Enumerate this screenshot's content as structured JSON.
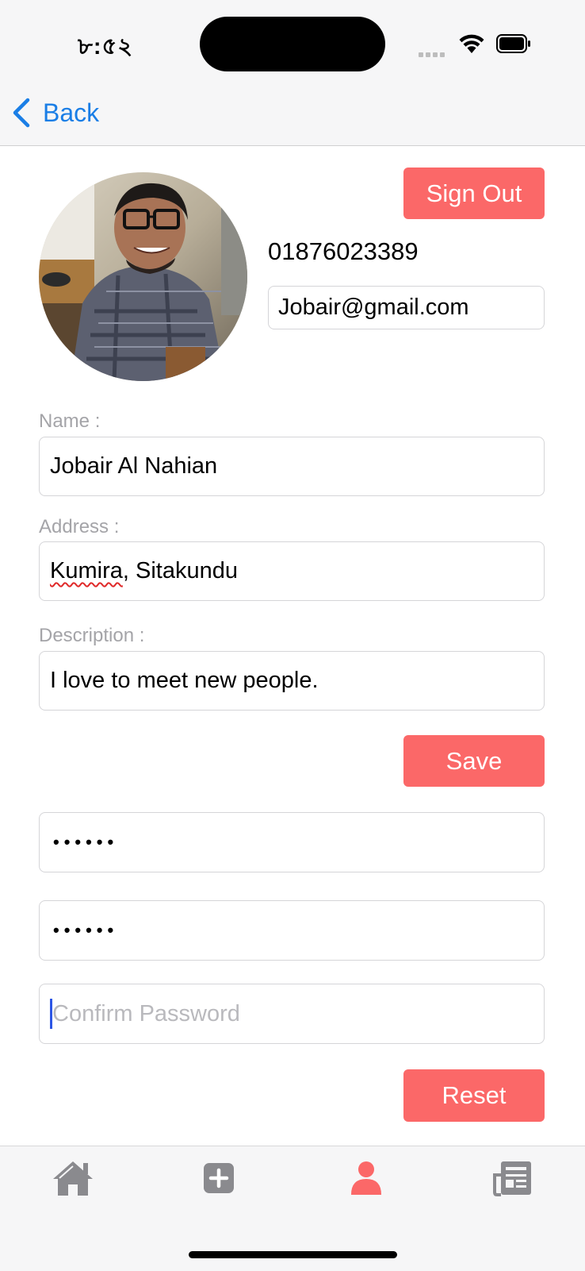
{
  "status_bar": {
    "time": "৮:৫২"
  },
  "nav": {
    "back_label": "Back"
  },
  "profile": {
    "sign_out_label": "Sign Out",
    "phone": "01876023389",
    "email": "Jobair@gmail.com"
  },
  "form": {
    "name_label": "Name :",
    "name_value": "Jobair Al Nahian",
    "address_label": "Address :",
    "address_value_underlined": "Kumira",
    "address_value_rest": ", Sitakundu",
    "description_label": "Description :",
    "description_value": "I love to meet new people.",
    "save_label": "Save"
  },
  "password": {
    "current_masked": "••••••",
    "new_masked": "••••••",
    "confirm_placeholder": "Confirm Password",
    "reset_label": "Reset"
  },
  "tabbar": {
    "items": [
      {
        "icon": "home-icon",
        "active": false
      },
      {
        "icon": "plus-square-icon",
        "active": false
      },
      {
        "icon": "person-icon",
        "active": true
      },
      {
        "icon": "newspaper-icon",
        "active": false
      }
    ]
  },
  "colors": {
    "accent": "#fb6868",
    "link": "#1a7ee6",
    "tab_inactive": "#8a8a8e",
    "tab_active": "#fb6868"
  }
}
